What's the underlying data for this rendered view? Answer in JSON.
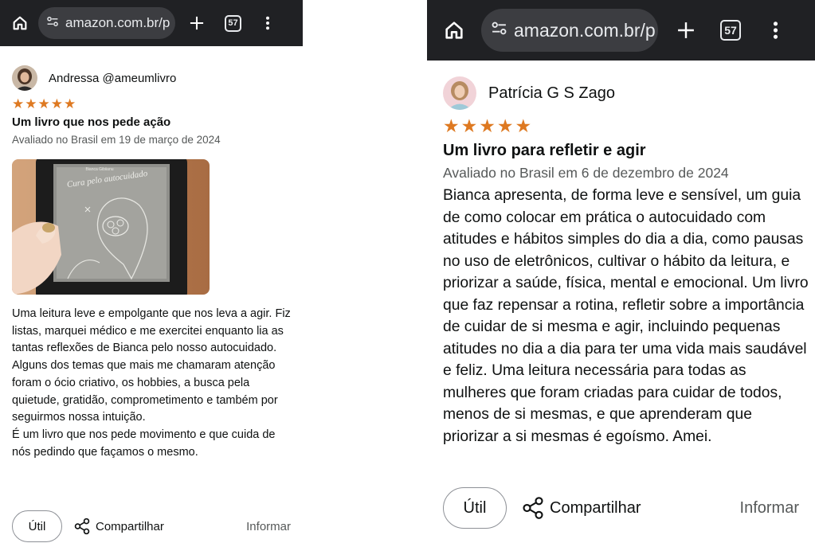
{
  "screenshots": [
    {
      "browser": {
        "url": "amazon.com.br/p",
        "tab_count": "57"
      },
      "review": {
        "reviewer": "Andressa @ameumlivro",
        "rating": 5,
        "stars": [
          "★",
          "★",
          "★",
          "★",
          "★"
        ],
        "title": "Um livro que nos pede ação",
        "date": "Avaliado no Brasil em 19 de março de 2024",
        "photo": {
          "book_title": "Cura pelo autocuidado",
          "book_author": "Bianca Gibiianu"
        },
        "body": "Uma leitura leve e empolgante que nos leva a agir. Fiz listas, marquei médico e me exercitei enquanto lia as tantas reflexões de Bianca pelo nosso autocuidado.\nAlguns dos temas que mais me chamaram atenção foram o ócio criativo, os hobbies, a busca pela quietude, gratidão, comprometimento e também por seguirmos nossa intuição.\nÉ um livro que nos pede movimento e que cuida de nós pedindo que façamos o mesmo."
      },
      "actions": {
        "helpful": "Útil",
        "share": "Compartilhar",
        "report": "Informar"
      }
    },
    {
      "browser": {
        "url": "amazon.com.br/p",
        "tab_count": "57"
      },
      "review": {
        "reviewer": "Patrícia G S Zago",
        "rating": 5,
        "stars": [
          "★",
          "★",
          "★",
          "★",
          "★"
        ],
        "title": "Um livro para refletir e agir",
        "date": "Avaliado no Brasil em 6 de dezembro de 2024",
        "body": "Bianca apresenta, de forma leve e sensível, um guia de como colocar em prática o autocuidado com atitudes e hábitos simples do dia a dia, como pausas no uso de eletrônicos, cultivar o hábito da leitura, e priorizar a saúde, física, mental e emocional. Um livro que faz repensar a rotina, refletir sobre a importância de cuidar de si mesma e agir, incluindo pequenas atitudes no dia a dia para ter uma vida mais saudável e feliz. Uma leitura necessária para todas as mulheres que foram criadas para cuidar de todos, menos de si mesmas, e que aprenderam que priorizar a si mesmas é egoísmo. Amei."
      },
      "actions": {
        "helpful": "Útil",
        "share": "Compartilhar",
        "report": "Informar"
      }
    }
  ],
  "colors": {
    "browser_bar": "#202124",
    "url_pill": "#3c3d41",
    "star": "#de7921",
    "muted_text": "#565959"
  },
  "icons": [
    "home-icon",
    "site-settings-icon",
    "plus-icon",
    "tab-switcher-icon",
    "more-vert-icon",
    "share-icon"
  ]
}
